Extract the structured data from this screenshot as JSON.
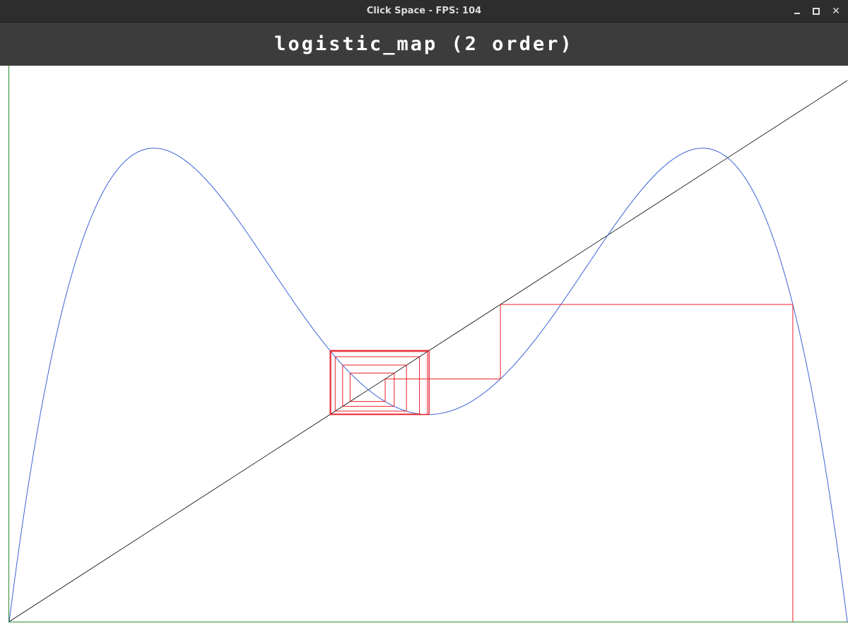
{
  "window": {
    "title": "Click Space - FPS: 104",
    "controls": {
      "minimize_icon": "minimize-icon",
      "maximize_icon": "maximize-icon",
      "close_icon": "close-icon",
      "close_glyph": "✕"
    }
  },
  "header": {
    "title": "logistic_map (2 order)"
  },
  "colors": {
    "titlebar_bg": "#2d2d2d",
    "header_bg": "#3c3c3c",
    "curve": "#3b62d6",
    "diagonal": "#000000",
    "cobweb": "#e8202a",
    "frame": "#2e8b2e"
  },
  "chart_data": {
    "type": "line",
    "title": "",
    "xlabel": "",
    "ylabel": "",
    "xlim": [
      0,
      1
    ],
    "ylim": [
      0,
      1
    ],
    "grid": false,
    "series": [
      {
        "kind": "function",
        "rule": "f(f(x)) where f(x) = r*x*(1-x)",
        "r": 3.5
      },
      {
        "kind": "identity",
        "rule": "y = x"
      },
      {
        "kind": "cobweb",
        "x0": 0.935,
        "x": [
          0.935,
          0.675,
          0.59,
          0.504,
          0.488,
          0.5,
          0.497,
          0.47,
          0.42,
          0.51,
          0.54,
          0.39,
          0.37,
          0.45,
          0.5
        ],
        "y": [
          0.655,
          0.575,
          0.42,
          0.39,
          0.45,
          0.495,
          0.5,
          0.44,
          0.41,
          0.35,
          0.345,
          0.39,
          0.49,
          0.4,
          0.5
        ]
      }
    ]
  }
}
